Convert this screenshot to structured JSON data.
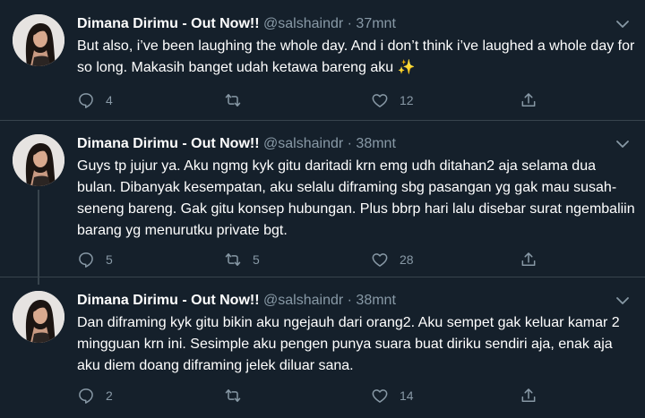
{
  "tweets": [
    {
      "name": "Dimana Dirimu - Out Now!!",
      "handle": "@salshaindr",
      "time": "37mnt",
      "text": "But also, i’ve been laughing the whole day. And i don’t think i’ve laughed a whole day for so long. Makasih banget udah ketawa bareng aku ✨",
      "replies": "4",
      "retweets": "",
      "likes": "12"
    },
    {
      "name": "Dimana Dirimu - Out Now!!",
      "handle": "@salshaindr",
      "time": "38mnt",
      "text": "Guys tp jujur ya. Aku ngmg kyk gitu daritadi krn emg udh ditahan2 aja selama dua bulan. Dibanyak kesempatan, aku selalu diframing sbg pasangan yg gak mau susah-seneng bareng. Gak gitu konsep hubungan. Plus bbrp hari lalu disebar surat ngembaliin barang yg menurutku private bgt.",
      "replies": "5",
      "retweets": "5",
      "likes": "28"
    },
    {
      "name": "Dimana Dirimu - Out Now!!",
      "handle": "@salshaindr",
      "time": "38mnt",
      "text": "Dan diframing kyk gitu bikin aku ngejauh dari orang2. Aku sempet gak keluar kamar 2 mingguan krn ini. Sesimple aku pengen punya suara buat diriku sendiri aja, enak aja aku diem doang diframing jelek diluar sana.",
      "replies": "2",
      "retweets": "",
      "likes": "14"
    }
  ]
}
